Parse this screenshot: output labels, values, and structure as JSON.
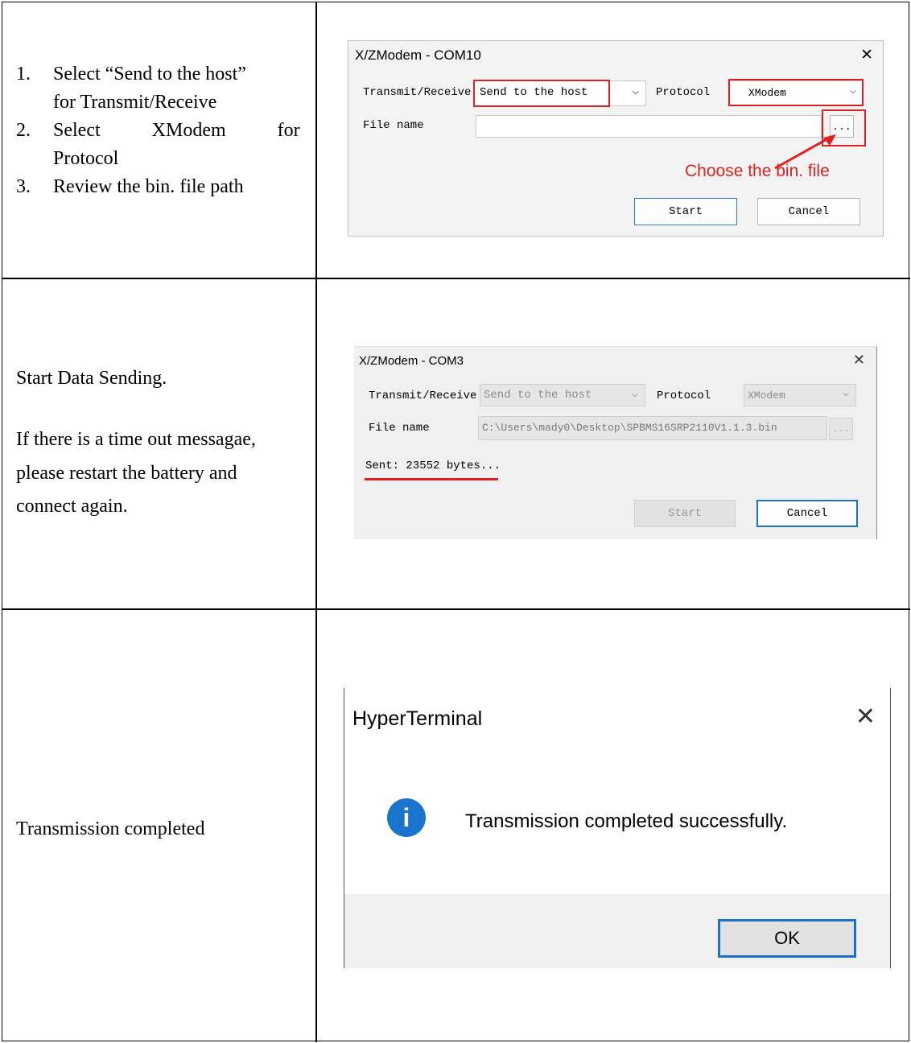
{
  "row1": {
    "steps": [
      {
        "num": "1.",
        "line1": "Select “Send to the host”",
        "line2": "for Transmit/Receive"
      },
      {
        "num": "2.",
        "line1": "Select XModem for",
        "line2": "Protocol"
      },
      {
        "num": "3.",
        "line1": "Review the bin. file path",
        "line2": ""
      }
    ],
    "dialog": {
      "title": "X/ZModem - COM10",
      "close": "✕",
      "transmit_label": "Transmit/Receive",
      "transmit_value": "Send to the host",
      "protocol_label": "Protocol",
      "protocol_value": "XModem",
      "filename_label": "File name",
      "filename_value": "",
      "browse": "...",
      "annotation": "Choose the bin. file",
      "start": "Start",
      "cancel": "Cancel",
      "chevron": "⌵"
    }
  },
  "row2": {
    "line1": "Start Data Sending.",
    "line2": "If there is a time out messagae,",
    "line3": "please restart the battery and",
    "line4": "connect again.",
    "dialog": {
      "title": "X/ZModem - COM3",
      "close": "✕",
      "transmit_label": "Transmit/Receive",
      "transmit_value": "Send to the host",
      "protocol_label": "Protocol",
      "protocol_value": "XModem",
      "filename_label": "File name",
      "filename_value": "C:\\Users\\mady0\\Desktop\\SPBMS16SRP2110V1.1.3.bin",
      "browse": "...",
      "status": "Sent: 23552 bytes...",
      "start": "Start",
      "cancel": "Cancel",
      "chevron": "⌵"
    }
  },
  "row3": {
    "text": "Transmission completed",
    "dialog": {
      "title": "HyperTerminal",
      "close": "✕",
      "info_glyph": "i",
      "message": "Transmission completed successfully.",
      "ok": "OK"
    }
  },
  "colors": {
    "highlight": "#e02020",
    "accent_blue": "#1a73c8",
    "info_blue": "#1874cd"
  }
}
